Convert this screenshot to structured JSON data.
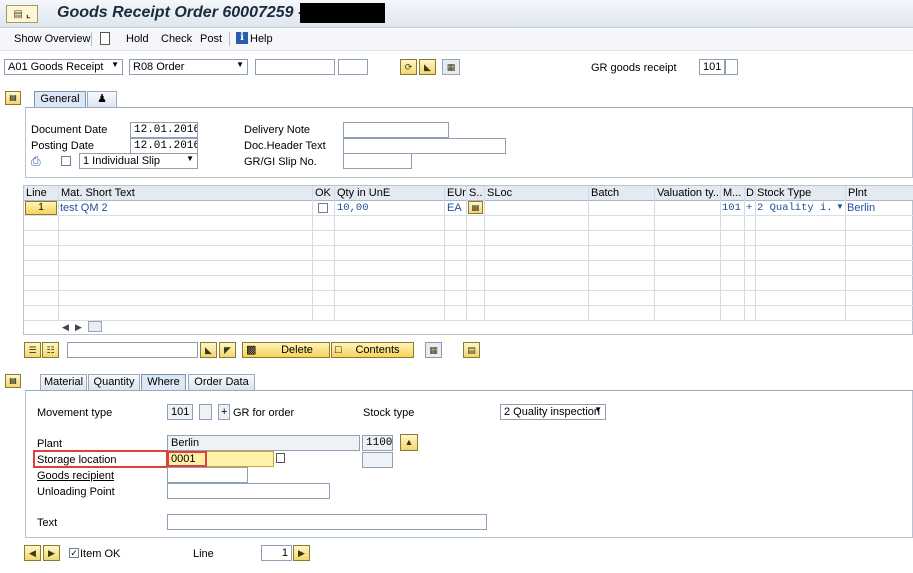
{
  "window": {
    "title": "Goods Receipt Order 60007259 -"
  },
  "toolbar": {
    "show_overview": "Show Overview",
    "hold": "Hold",
    "check": "Check",
    "post": "Post",
    "help": "Help"
  },
  "header": {
    "transaction": "A01 Goods Receipt",
    "reference": "R08 Order",
    "gr_label": "GR goods receipt",
    "movement_type": "101"
  },
  "general_tab": {
    "tab_label": "General",
    "document_date_label": "Document Date",
    "document_date": "12.01.2016",
    "posting_date_label": "Posting Date",
    "posting_date": "12.01.2016",
    "slip_option": "1 Individual Slip",
    "delivery_note_label": "Delivery Note",
    "doc_header_text_label": "Doc.Header Text",
    "grgi_slip_no_label": "GR/GI Slip No."
  },
  "items_table": {
    "columns": [
      "Line",
      "Mat. Short Text",
      "OK",
      "Qty in UnE",
      "EUn",
      "S..",
      "SLoc",
      "Batch",
      "Valuation ty...",
      "M...",
      "D",
      "Stock Type",
      "Plnt"
    ],
    "rows": [
      {
        "line": "1",
        "mat_short_text": "test QM 2",
        "qty": "10,00",
        "eun": "EA",
        "movement": "101",
        "d": "+",
        "stock_type": "2 Quality i.",
        "plnt": "Berlin"
      }
    ]
  },
  "table_toolbar": {
    "delete_label": "Delete",
    "contents_label": "Contents"
  },
  "detail_tabs": {
    "material": "Material",
    "quantity": "Quantity",
    "where": "Where",
    "order_data": "Order Data"
  },
  "where_tab": {
    "movement_type_label": "Movement type",
    "movement_type": "101",
    "plus_sign": "+",
    "gr_for_order": "GR for order",
    "stock_type_label": "Stock type",
    "stock_type": "2 Quality inspection",
    "plant_label": "Plant",
    "plant_name": "Berlin",
    "plant_code": "1100",
    "storage_location_label": "Storage location",
    "storage_location": "0001",
    "goods_recipient_label": "Goods recipient",
    "unloading_point_label": "Unloading Point",
    "text_label": "Text"
  },
  "footer": {
    "item_ok_label": "Item OK",
    "line_label": "Line",
    "line_value": "1"
  },
  "colors": {
    "highlight_red": "#e0403a",
    "required_yellow": "#fff2a8",
    "link_blue": "#1f4f9a"
  }
}
